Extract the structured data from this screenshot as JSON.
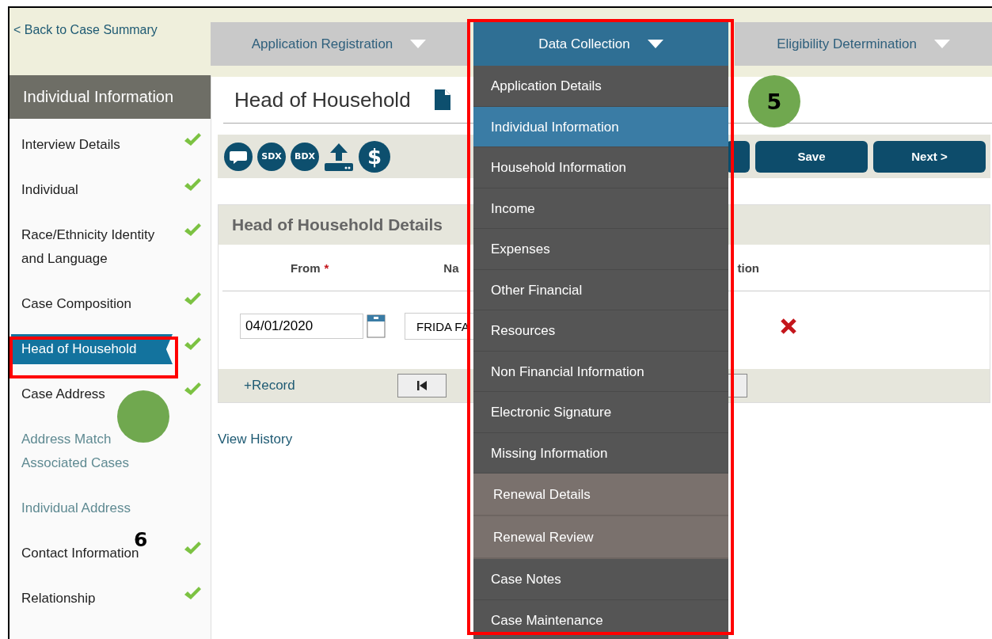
{
  "back_link": "< Back to Case Summary",
  "nav_tabs": [
    {
      "label": "Application Registration",
      "selected": false
    },
    {
      "label": "Data Collection",
      "selected": true
    },
    {
      "label": "Eligibility Determination",
      "selected": false
    }
  ],
  "sidebar": {
    "title": "Individual Information",
    "items": [
      {
        "label": "Interview Details",
        "kind": "step",
        "complete": true,
        "selected": false
      },
      {
        "label": "Individual",
        "kind": "step",
        "complete": true,
        "selected": false
      },
      {
        "label": "Race/Ethnicity Identity and Language",
        "kind": "step",
        "complete": true,
        "selected": false
      },
      {
        "label": "Case Composition",
        "kind": "step",
        "complete": true,
        "selected": false
      },
      {
        "label": "Head of Household",
        "kind": "step",
        "complete": true,
        "selected": true
      },
      {
        "label": "Case Address",
        "kind": "step",
        "complete": true,
        "selected": false
      },
      {
        "label": "Address Match Associated Cases",
        "kind": "link",
        "complete": false,
        "selected": false
      },
      {
        "label": "Individual Address",
        "kind": "link",
        "complete": false,
        "selected": false
      },
      {
        "label": "Contact Information",
        "kind": "step",
        "complete": true,
        "selected": false
      },
      {
        "label": "Relationship",
        "kind": "step",
        "complete": true,
        "selected": false
      }
    ]
  },
  "page_title": "Head of Household",
  "toolbar": {
    "icons": [
      {
        "kind": "chat"
      },
      {
        "kind": "badge",
        "label": "SDX"
      },
      {
        "kind": "badge",
        "label": "BDX"
      },
      {
        "kind": "upload"
      },
      {
        "kind": "badge",
        "label": "$"
      }
    ],
    "buttons": [
      "Save",
      "Next >"
    ]
  },
  "details": {
    "title": "Head of Household Details",
    "required_mark": "*",
    "columns": [
      {
        "label": "From",
        "required": true
      },
      {
        "label": "Na",
        "required": false
      },
      {
        "label": "tion",
        "required": false
      }
    ],
    "row": {
      "from": "04/01/2020",
      "name": "FRIDA FA"
    },
    "add_record": "+Record"
  },
  "view_history": "View History",
  "menu": {
    "items": [
      {
        "label": "Application Details",
        "kind": "main",
        "selected": false
      },
      {
        "label": "Individual Information",
        "kind": "main",
        "selected": true
      },
      {
        "label": "Household Information",
        "kind": "main",
        "selected": false
      },
      {
        "label": "Income",
        "kind": "main",
        "selected": false
      },
      {
        "label": "Expenses",
        "kind": "main",
        "selected": false
      },
      {
        "label": "Other Financial",
        "kind": "main",
        "selected": false
      },
      {
        "label": "Resources",
        "kind": "main",
        "selected": false
      },
      {
        "label": "Non Financial Information",
        "kind": "main",
        "selected": false
      },
      {
        "label": "Electronic Signature",
        "kind": "main",
        "selected": false
      },
      {
        "label": "Missing Information",
        "kind": "main",
        "selected": false
      },
      {
        "label": "Renewal Details",
        "kind": "renewal",
        "selected": false
      },
      {
        "label": "Renewal Review",
        "kind": "renewal",
        "selected": false
      },
      {
        "label": "Case Notes",
        "kind": "main",
        "selected": false
      },
      {
        "label": "Case Maintenance",
        "kind": "main",
        "selected": false
      }
    ]
  },
  "annotations": [
    {
      "kind": "frame"
    },
    {
      "kind": "frame"
    },
    {
      "kind": "circle",
      "label": "5"
    },
    {
      "kind": "circle"
    },
    {
      "kind": "number",
      "label": "6"
    }
  ]
}
